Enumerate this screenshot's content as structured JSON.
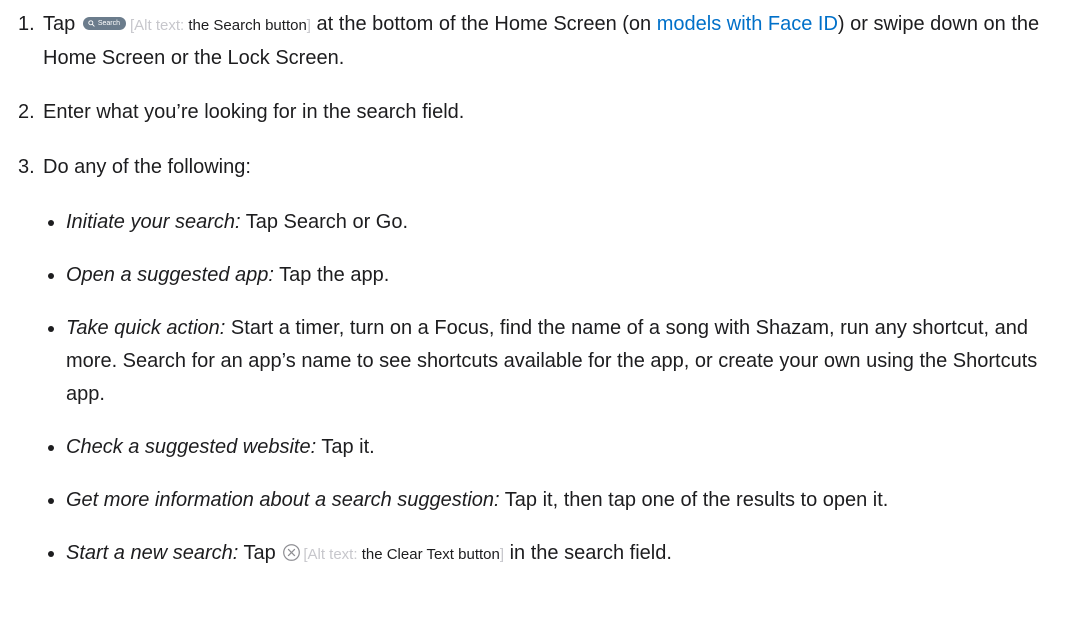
{
  "steps": [
    {
      "number": "1.",
      "text_before": "Tap",
      "search_pill_label": "Search",
      "alt_prefix": "Alt text:",
      "alt_desc": "the Search button",
      "text_after": "at the bottom of the Home Screen (on",
      "link_text": "models with Face ID",
      "text_end": ") or swipe down on the Home Screen or the Lock Screen."
    },
    {
      "number": "2.",
      "text": "Enter what you’re looking for in the search field."
    },
    {
      "number": "3.",
      "text": "Do any of the following:"
    }
  ],
  "bullets": [
    {
      "term": "Initiate your search:",
      "text": "Tap Search or Go."
    },
    {
      "term": "Open a suggested app:",
      "text": "Tap the app."
    },
    {
      "term": "Take quick action:",
      "text": "Start a timer, turn on a Focus, find the name of a song with Shazam, run any shortcut, and more. Search for an app’s name to see shortcuts available for the app, or create your own using the Shortcuts app."
    },
    {
      "term": "Check a suggested website:",
      "text": "Tap it."
    },
    {
      "term": "Get more information about a search suggestion:",
      "text": "Tap it, then tap one of the results to open it."
    },
    {
      "term": "Start a new search:",
      "text_before": "Tap",
      "alt_prefix": "Alt text:",
      "alt_desc": "the Clear Text button",
      "text_after": "in the search field."
    }
  ],
  "icons": {
    "search_pill": "magnifier-icon",
    "clear_text": "circled-x-icon"
  },
  "colors": {
    "text": "#1d1d1f",
    "link": "#0070c9",
    "alt_text_muted": "#c7c7cc",
    "search_pill_bg": "#6b7c8c"
  }
}
